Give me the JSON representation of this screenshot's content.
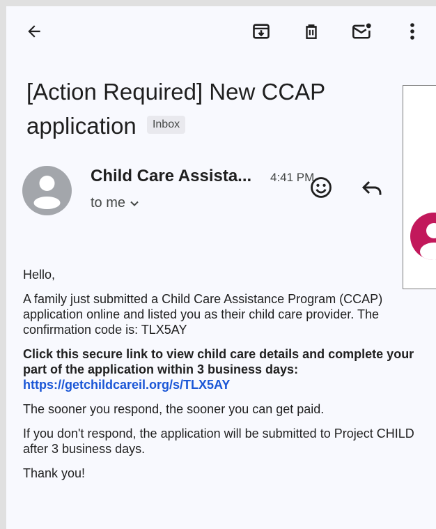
{
  "toolbar": {
    "back_icon": "arrow-left-icon",
    "archive_icon": "archive-icon",
    "delete_icon": "trash-icon",
    "mark_unread_icon": "mail-unread-icon",
    "more_icon": "more-vert-icon"
  },
  "message": {
    "subject": "[Action Required] New CCAP application",
    "label_chip": "Inbox",
    "sender_name": "Child Care Assista...",
    "time": "4:41 PM",
    "recipient": "to me"
  },
  "body": {
    "greeting": "Hello,",
    "para1": "A family just submitted a Child Care Assistance Program (CCAP) application online and listed you as their child care provider. The confirmation code is: ",
    "confirmation_code": "TLX5AY",
    "cta": "Click this secure link to view child care details and complete your part of the application within 3 business days:",
    "link": "https://getchildcareil.org/s/TLX5AY",
    "para2": "The sooner you respond, the sooner you can get paid.",
    "para3": "If you don't respond, the application will be submitted to Project CHILD after 3 business days.",
    "closing": "Thank you!"
  },
  "colors": {
    "background": "#f8f9fe",
    "link": "#1a56d6",
    "avatar": "#a3a6ab",
    "side_badge": "#c2185b"
  }
}
